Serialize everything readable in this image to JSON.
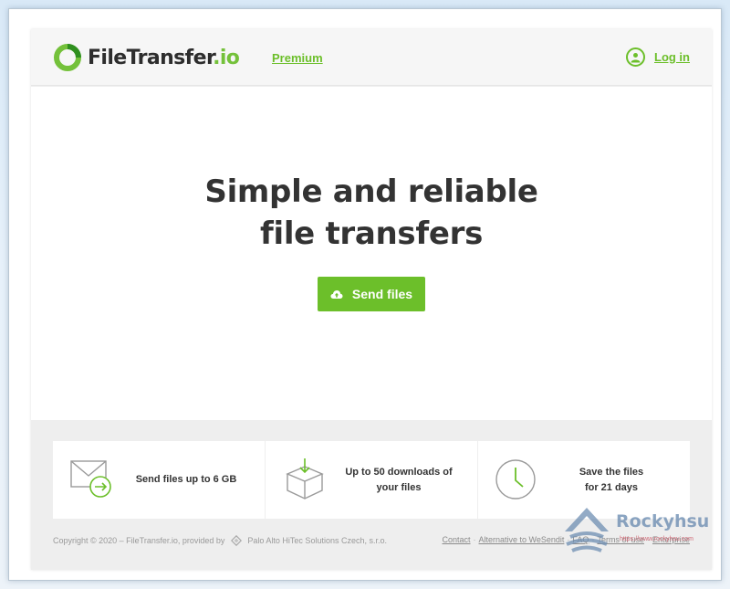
{
  "header": {
    "logo_name": "FileTransfer",
    "logo_tld": ".io",
    "premium_label": "Premium",
    "login_label": "Log in"
  },
  "hero": {
    "title_line1": "Simple and reliable",
    "title_line2": "file transfers",
    "send_label": "Send files"
  },
  "features": [
    {
      "icon": "envelope-arrow-icon",
      "line1": "Send files up to 6 GB",
      "line2": ""
    },
    {
      "icon": "box-download-icon",
      "line1": "Up to 50 downloads of",
      "line2": "your files"
    },
    {
      "icon": "clock-icon",
      "line1": "Save the files",
      "line2": "for 21 days"
    }
  ],
  "footer": {
    "copyright": "Copyright © 2020 – FileTransfer.io, provided by",
    "provider": "Palo Alto HiTec Solutions Czech, s.r.o.",
    "links": [
      "Contact",
      "Alternative to WeSendit",
      "FAQ",
      "Terms of use",
      "Enterprise"
    ],
    "separator": "·"
  },
  "watermark": {
    "name": "Rockyhsu",
    "url": "https://www.rockyhsu.com"
  },
  "colors": {
    "accent": "#6cbf2a",
    "text": "#333333"
  }
}
